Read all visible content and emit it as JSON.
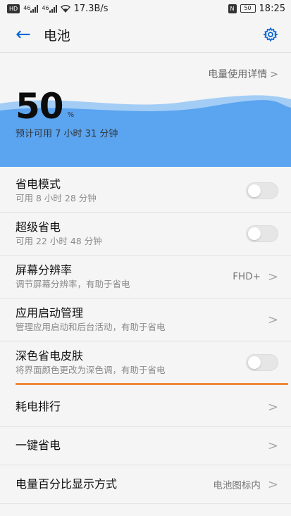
{
  "status_bar": {
    "net_type": "HD",
    "sig1": "46",
    "sig2": "46",
    "speed": "17.3B/s",
    "nfc": "N",
    "battery": "50",
    "time": "18:25"
  },
  "header": {
    "title": "电池",
    "back_icon": "back-arrow-icon",
    "settings_icon": "gear-icon"
  },
  "usage_link": {
    "label": "电量使用详情",
    "chevron": ">"
  },
  "battery": {
    "percent": "50",
    "percent_sign": "%",
    "remaining": "预计可用 7 小时 31 分钟",
    "level": 0.5
  },
  "rows": [
    {
      "title": "省电模式",
      "sub": "可用 8 小时 28 分钟",
      "toggle_on": false
    },
    {
      "title": "超级省电",
      "sub": "可用 22 小时 48 分钟",
      "toggle_on": false
    },
    {
      "title": "屏幕分辨率",
      "sub": "调节屏幕分辨率，有助于省电",
      "value": "FHD+",
      "chevron": ">"
    },
    {
      "title": "应用启动管理",
      "sub": "管理应用启动和后台活动，有助于省电",
      "chevron": ">"
    },
    {
      "title": "深色省电皮肤",
      "sub": "将界面颜色更改为深色调，有助于省电",
      "toggle_on": false
    },
    {
      "title": "耗电排行",
      "chevron": ">"
    },
    {
      "title": "一键省电",
      "chevron": ">"
    },
    {
      "title": "电量百分比显示方式",
      "value": "电池图标内",
      "chevron": ">"
    }
  ],
  "colors": {
    "accent": "#0b68d6",
    "wave_light": "#8fc3f5",
    "wave_main": "#5aa4f0",
    "highlight": "#f0883a"
  }
}
